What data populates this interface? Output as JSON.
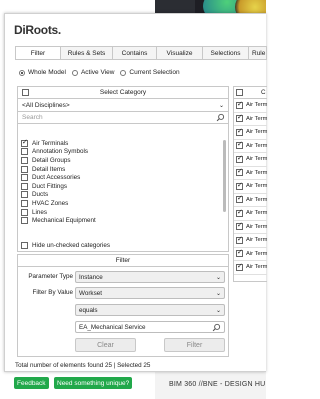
{
  "background": {
    "footer_text": "BIM 360 //BNE - DESIGN HU",
    "colors": {
      "dark": "#2b2d33",
      "green_button": "#21a84a"
    }
  },
  "app": {
    "logo": "DiRoots."
  },
  "tabs": [
    {
      "label": "Filter",
      "active": true
    },
    {
      "label": "Rules & Sets",
      "active": false
    },
    {
      "label": "Contains",
      "active": false
    },
    {
      "label": "Visualize",
      "active": false
    },
    {
      "label": "Selections",
      "active": false
    },
    {
      "label": "Rule",
      "active": false
    }
  ],
  "scope": {
    "options": [
      "Whole Model",
      "Active View",
      "Current Selection"
    ],
    "selected": "Whole Model"
  },
  "category_panel": {
    "title": "Select Category",
    "discipline": "<All Disciplines>",
    "search_placeholder": "Search",
    "items": [
      {
        "label": "Air Terminals",
        "checked": true
      },
      {
        "label": "Annotation Symbols",
        "checked": false
      },
      {
        "label": "Detail Groups",
        "checked": false
      },
      {
        "label": "Detail Items",
        "checked": false
      },
      {
        "label": "Duct Accessories",
        "checked": false
      },
      {
        "label": "Duct Fittings",
        "checked": false
      },
      {
        "label": "Ducts",
        "checked": false
      },
      {
        "label": "HVAC Zones",
        "checked": false
      },
      {
        "label": "Lines",
        "checked": false
      },
      {
        "label": "Mechanical Equipment",
        "checked": false
      }
    ],
    "hide_unchecked_label": "Hide un-checked categories"
  },
  "filter_panel": {
    "title": "Filter",
    "parameter_type_label": "Parameter Type",
    "parameter_type_value": "Instance",
    "filter_by_value_label": "Filter By Value",
    "filter_by_value": "Workset",
    "operator": "equals",
    "value": "EA_Mechanical Service",
    "clear_label": "Clear",
    "filter_label": "Filter"
  },
  "results": {
    "column_header": "C",
    "rows": [
      "Air Termi",
      "Air Termi",
      "Air Termi",
      "Air Termi",
      "Air Termi",
      "Air Termi",
      "Air Termi",
      "Air Termi",
      "Air Termi",
      "Air Termi",
      "Air Termi",
      "Air Termi",
      "Air Termi"
    ]
  },
  "status": {
    "total_text": "Total number of elements found 25 | Selected 25"
  },
  "footer_buttons": {
    "feedback": "Feedback",
    "unique": "Need something unique?"
  }
}
